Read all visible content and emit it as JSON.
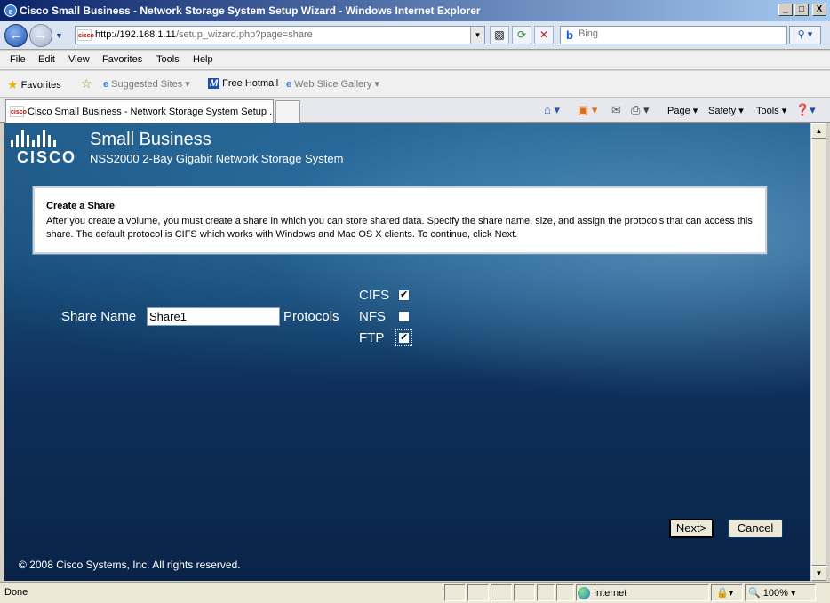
{
  "window": {
    "title": "Cisco Small Business - Network Storage System Setup Wizard - Windows Internet Explorer",
    "controls": {
      "minimize": "_",
      "maximize": "□",
      "close": "X"
    }
  },
  "nav": {
    "url_host": "http://192.168.1.11",
    "url_path": "/setup_wizard.php?page=share",
    "search_placeholder": "Bing",
    "site_icon_text": "cisco"
  },
  "menu": [
    "File",
    "Edit",
    "View",
    "Favorites",
    "Tools",
    "Help"
  ],
  "favorites_bar": {
    "favorites": "Favorites",
    "suggested": "Suggested Sites ▾",
    "hotmail": "Free Hotmail",
    "slice": "Web Slice Gallery ▾"
  },
  "tab": {
    "label": "Cisco Small Business - Network Storage System Setup ..."
  },
  "commandbar": {
    "page": "Page ▾",
    "safety": "Safety ▾",
    "tools": "Tools ▾"
  },
  "page": {
    "brand": "Small Business",
    "logo_text": "CISCO",
    "product": "NSS2000 2-Bay Gigabit Network Storage System",
    "info": {
      "heading": "Create a Share",
      "body": "After you create a volume, you must create a share in which you can store shared data. Specify the share name, size, and assign the protocols that can access this share. The default protocol is CIFS which works with Windows and Mac OS X clients. To continue, click Next."
    },
    "form": {
      "share_name_label": "Share Name",
      "share_name_value": "Share1",
      "protocols_label": "Protocols",
      "protocols": [
        {
          "name": "CIFS",
          "checked": true
        },
        {
          "name": "NFS",
          "checked": false
        },
        {
          "name": "FTP",
          "checked": true
        }
      ]
    },
    "buttons": {
      "next": "Next>",
      "cancel": "Cancel"
    },
    "copyright": "© 2008 Cisco Systems, Inc. All rights reserved."
  },
  "status": {
    "text": "Done",
    "zone": "Internet",
    "zoom": "100%"
  }
}
